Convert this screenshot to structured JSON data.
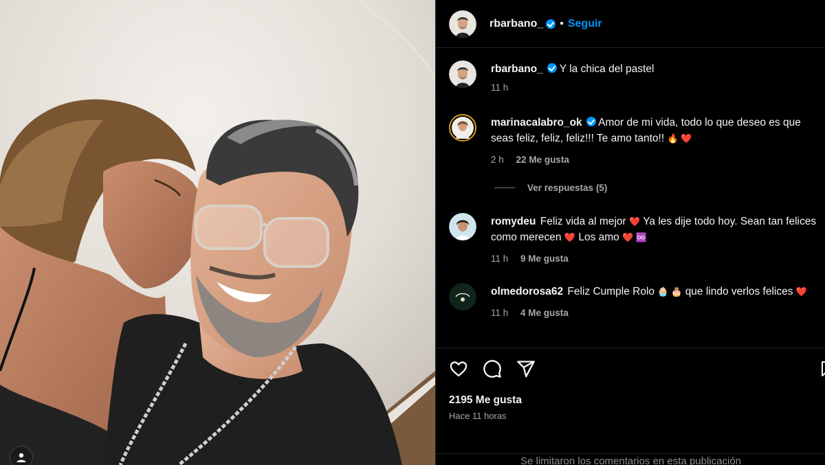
{
  "post": {
    "author": "rbarbano_",
    "follow_label": "Seguir",
    "separator": "•"
  },
  "caption": {
    "user": "rbarbano_",
    "text": "Y la chica del pastel",
    "time": "11 h"
  },
  "comments": [
    {
      "user": "marinacalabro_ok",
      "verified": true,
      "text": "Amor de mi vida, todo lo que deseo es que seas feliz, feliz, feliz!!! Te amo tanto!!",
      "emoji": "🔥 ❤️",
      "time": "2 h",
      "likes": "22 Me gusta"
    },
    {
      "user": "romydeu",
      "verified": false,
      "text_a": "Feliz vida al mejor",
      "emoji_a": "❤️",
      "text_b": "Ya les dije todo hoy. Sean tan felices como merecen",
      "emoji_b": "❤️",
      "text_c": "Los amo",
      "emoji_c": "❤️ ♾️",
      "time": "11 h",
      "likes": "9 Me gusta"
    },
    {
      "user": "olmedorosa62",
      "verified": false,
      "text_a": "Feliz Cumple Rolo",
      "emoji_a": "🧁 🎂",
      "text_b": "que lindo verlos felices",
      "emoji_b": "❤️",
      "time": "11 h",
      "likes": "4 Me gusta"
    }
  ],
  "view_replies": "Ver respuestas (5)",
  "footer": {
    "likes": "2195 Me gusta",
    "posted": "Hace 11 horas",
    "comments_limited": "Se limitaron los comentarios en esta publicación"
  },
  "colors": {
    "accent": "#0095f6",
    "background": "#000000",
    "muted_text": "#a8a8a8",
    "border": "#262626"
  },
  "icons": [
    "heart-icon",
    "comment-icon",
    "share-icon",
    "bookmark-icon",
    "verified-badge-icon",
    "user-tag-icon"
  ]
}
